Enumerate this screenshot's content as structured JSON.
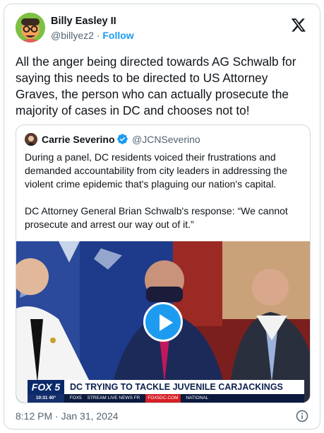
{
  "author": {
    "name": "Billy Easley II",
    "handle": "@billyez2",
    "separator": "·",
    "follow_label": "Follow"
  },
  "tweet": {
    "text": "All the anger being directed towards AG Schwalb for saying this needs to be directed to US Attorney Graves, the person who can actually prosecute the majority of cases in DC and chooses not to!",
    "timestamp": "8:12 PM · Jan 31, 2024"
  },
  "quoted": {
    "name": "Carrie Severino",
    "handle": "@JCNSeverino",
    "paragraph1": "During a panel, DC residents voiced their frustrations and demanded accountability from city leaders in addressing the violent crime epidemic that's plaguing our nation's capital.",
    "paragraph2": "DC Attorney General Brian Schwalb's response: “We cannot prosecute and arrest our way out of it.”"
  },
  "video": {
    "channel_logo": "FOX 5",
    "headline": "DC TRYING TO TACKLE JUVENILE CARJACKINGS",
    "ticker_time": "10:31  40°",
    "ticker_items": [
      "FOX5",
      "STREAM LIVE NEWS FR",
      "FOX5DC.COM",
      "NATIONAL"
    ]
  },
  "icons": {
    "logo": "x-logo-icon",
    "verified": "verified-badge-icon",
    "play": "play-icon",
    "info": "info-icon"
  },
  "colors": {
    "accent": "#1d9bf0",
    "muted_text": "#536471",
    "border": "#cfd9de"
  }
}
